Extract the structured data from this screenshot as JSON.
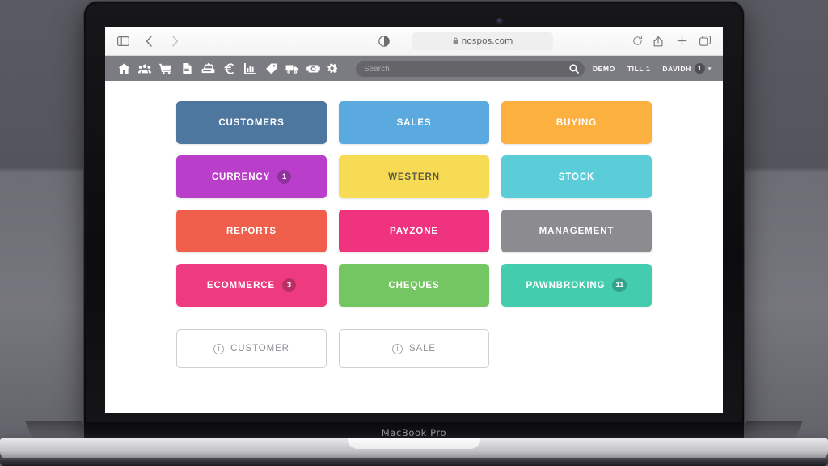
{
  "device": {
    "label": "MacBook Pro"
  },
  "browser": {
    "url": "nospos.com",
    "lock": "🔒",
    "sidebar_icon": "sidebar-icon",
    "back_icon": "chevron-left-icon",
    "forward_icon": "chevron-right-icon",
    "reader_icon": "reader-contrast-icon",
    "reload_icon": "reload-icon",
    "share_icon": "share-icon",
    "newtab_icon": "plus-icon",
    "tabs_icon": "tab-overview-icon"
  },
  "toolbar": {
    "nav_icons": [
      {
        "name": "home-icon",
        "title": "Home"
      },
      {
        "name": "customers-icon",
        "title": "Customers"
      },
      {
        "name": "cart-icon",
        "title": "Sales"
      },
      {
        "name": "document-icon",
        "title": "Documents"
      },
      {
        "name": "cash-register-icon",
        "title": "Till"
      },
      {
        "name": "euro-icon",
        "title": "Currency"
      },
      {
        "name": "bar-chart-icon",
        "title": "Reports"
      },
      {
        "name": "tag-icon",
        "title": "Stock"
      },
      {
        "name": "truck-icon",
        "title": "Deliveries"
      },
      {
        "name": "camera-icon",
        "title": "Media"
      },
      {
        "name": "gears-icon",
        "title": "Settings"
      }
    ],
    "search": {
      "placeholder": "Search",
      "value": ""
    },
    "account": {
      "company": "DEMO",
      "till": "TILL 1",
      "user": "DAVIDH",
      "user_badge": "1",
      "caret": "▾"
    }
  },
  "main": {
    "tiles": [
      {
        "label": "CUSTOMERS",
        "color": "#4e77a0",
        "text_color": "#ffffff",
        "badge": null
      },
      {
        "label": "SALES",
        "color": "#5aaae0",
        "text_color": "#ffffff",
        "badge": null
      },
      {
        "label": "BUYING",
        "color": "#fbb040",
        "text_color": "#ffffff",
        "badge": null
      },
      {
        "label": "CURRENCY",
        "color": "#b93fcb",
        "text_color": "#ffffff",
        "badge": "1"
      },
      {
        "label": "WESTERN",
        "color": "#f7db55",
        "text_color": "#5c5c42",
        "badge": null
      },
      {
        "label": "STOCK",
        "color": "#5bcdd8",
        "text_color": "#ffffff",
        "badge": null
      },
      {
        "label": "REPORTS",
        "color": "#f05f4b",
        "text_color": "#ffffff",
        "badge": null
      },
      {
        "label": "PAYZONE",
        "color": "#f0337e",
        "text_color": "#ffffff",
        "badge": null
      },
      {
        "label": "MANAGEMENT",
        "color": "#8b8b90",
        "text_color": "#ffffff",
        "badge": null
      },
      {
        "label": "ECOMMERCE",
        "color": "#ee3b7f",
        "text_color": "#ffffff",
        "badge": "3"
      },
      {
        "label": "CHEQUES",
        "color": "#74c662",
        "text_color": "#ffffff",
        "badge": null
      },
      {
        "label": "PAWNBROKING",
        "color": "#43cdae",
        "text_color": "#ffffff",
        "badge": "11"
      }
    ],
    "actions": [
      {
        "label": "CUSTOMER",
        "icon": "plus-circle-icon"
      },
      {
        "label": "SALE",
        "icon": "plus-circle-icon"
      }
    ]
  }
}
